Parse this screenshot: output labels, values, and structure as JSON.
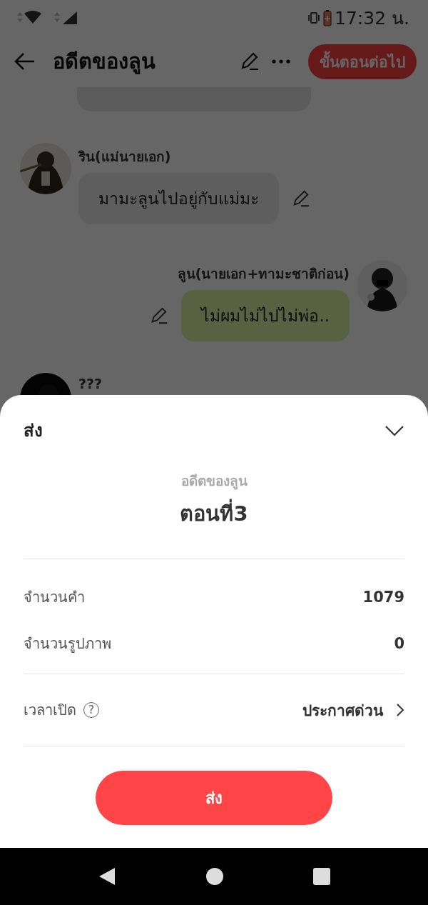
{
  "status_bar": {
    "time": "17:32 น."
  },
  "header": {
    "title": "อดีตของลูน",
    "next_button": "ขั้นตอนต่อไป"
  },
  "messages": [
    {
      "kind": "left",
      "sender": "ริน(แม่นายเอก)",
      "text": "มามะลูนไปอยู่กับแม่มะ"
    },
    {
      "kind": "right",
      "sender": "ลูน(นายเอก+ทามะชาติก่อน)",
      "text": "ไม่ผมไม่ไปไม่พ่อ.."
    },
    {
      "kind": "left",
      "sender": "???"
    }
  ],
  "sheet": {
    "title": "ส่ง",
    "novel": "อดีตของลูน",
    "episode": "ตอนที่3",
    "stats": [
      {
        "label": "จำนวนคำ",
        "value": "1079"
      },
      {
        "label": "จำนวนรูปภาพ",
        "value": "0"
      }
    ],
    "publish": {
      "label": "เวลาเปิด",
      "help": "?",
      "value": "ประกาศด่วน"
    },
    "submit": "ส่ง"
  }
}
